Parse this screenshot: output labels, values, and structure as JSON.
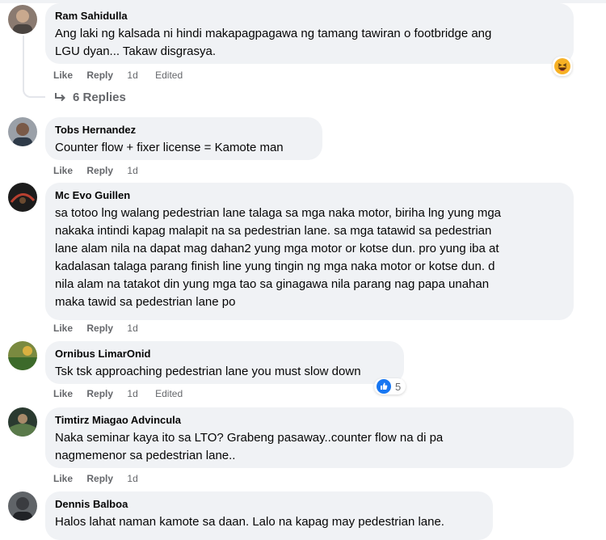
{
  "comments": [
    {
      "author": "Ram Sahidulla",
      "text": "Ang laki ng kalsada ni hindi makapagpagawa ng tamang tawiran o footbridge ang\nLGU dyan... Takaw disgrasya.",
      "like": "Like",
      "reply": "Reply",
      "time": "1d",
      "edited": "Edited",
      "reaction_icon": "haha-emoji-icon"
    },
    {
      "author": "Tobs Hernandez",
      "text": "Counter flow + fixer license = Kamote man",
      "like": "Like",
      "reply": "Reply",
      "time": "1d"
    },
    {
      "author": "Mc Evo Guillen",
      "text": "sa totoo lng walang pedestrian lane talaga sa mga naka motor, biriha lng yung mga\nnakaka intindi kapag malapit na sa pedestrian lane. sa mga tatawid sa pedestrian\nlane alam nila na dapat mag dahan2 yung mga motor or kotse dun. pro yung iba at\nkadalasan talaga parang finish line yung tingin ng mga naka motor or kotse dun. d\nnila alam na tatakot din yung mga tao sa ginagawa nila parang nag papa unahan\nmaka tawid sa pedestrian lane po",
      "like": "Like",
      "reply": "Reply",
      "time": "1d"
    },
    {
      "author": "Ornibus LimarOnid",
      "text": "Tsk tsk approaching pedestrian lane you must slow down",
      "like": "Like",
      "reply": "Reply",
      "time": "1d",
      "edited": "Edited",
      "reaction_icon": "like-thumb-icon",
      "reaction_count": "5"
    },
    {
      "author": "Timtirz Miagao Advincula",
      "text": "Naka seminar kaya ito sa LTO? Grabeng pasaway..counter flow na di pa\nnagmemenor sa pedestrian lane..",
      "like": "Like",
      "reply": "Reply",
      "time": "1d"
    },
    {
      "author": "Dennis Balboa",
      "text": "Halos lahat naman kamote sa daan. Lalo na kapag may pedestrian lane."
    }
  ],
  "replies_link": {
    "label": "6 Replies",
    "icon": "reply-arrow-icon"
  },
  "colors": {
    "bubble": "#f0f2f5",
    "muted": "#65676b",
    "like_blue": "#1877f2",
    "haha_yellow": "#f7b125"
  }
}
